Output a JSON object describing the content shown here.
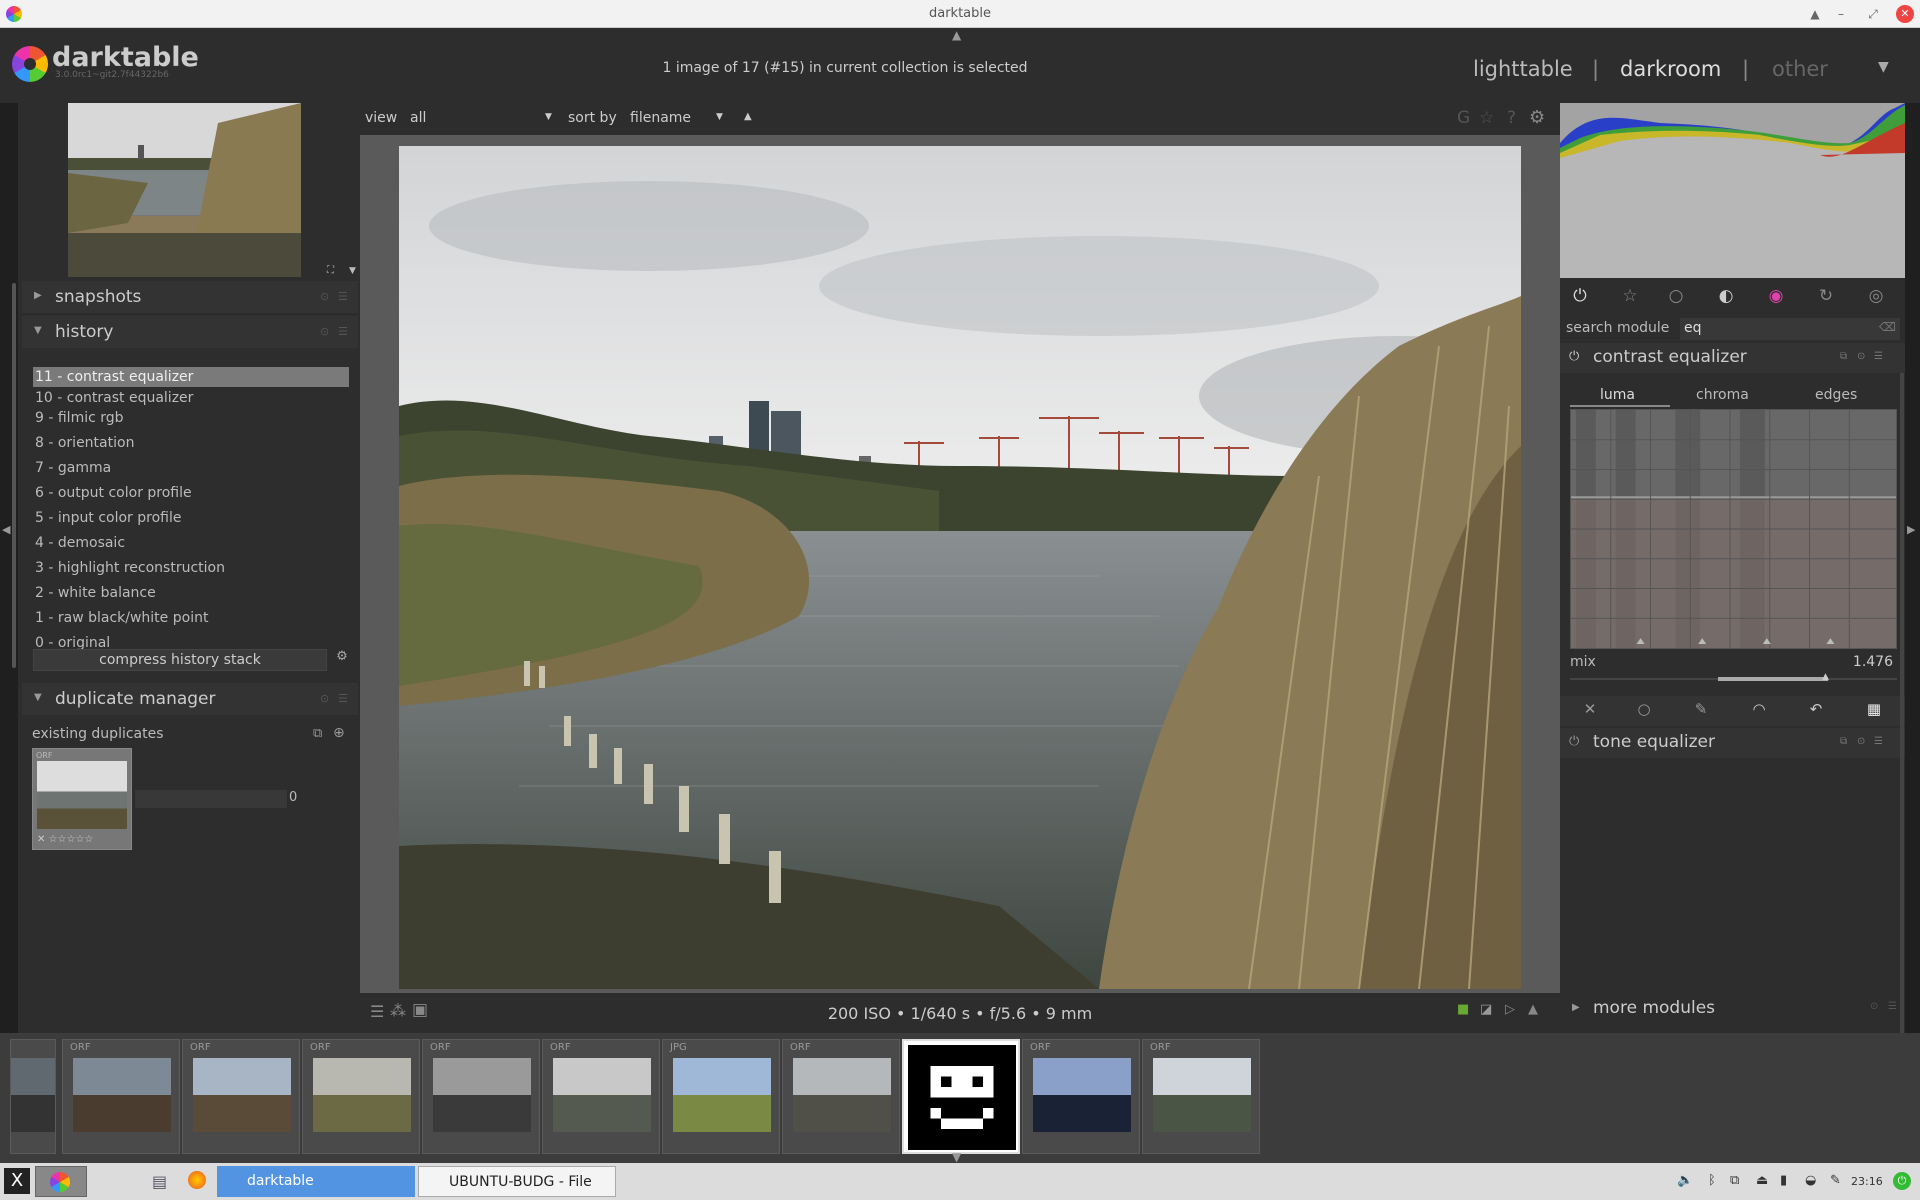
{
  "window": {
    "title": "darktable"
  },
  "header": {
    "logo": "darktable",
    "version": "3.0.0rc1~git2.7f44322b6",
    "selection_info": "1 image of 17 (#15) in current collection is selected",
    "views": {
      "lighttable": "lighttable",
      "sep1": "|",
      "darkroom": "darkroom",
      "sep2": "|",
      "other": "other"
    },
    "active_view": "darkroom"
  },
  "left": {
    "snapshots_label": "snapshots",
    "history_label": "history",
    "history_items": [
      "11 - contrast equalizer",
      "10 - contrast equalizer",
      "9 - filmic rgb",
      "8 - orientation",
      "7 - gamma",
      "6 - output color profile",
      "5 - input color profile",
      "4 - demosaic",
      "3 - highlight reconstruction",
      "2 - white balance",
      "1 - raw black/white point",
      "0 - original"
    ],
    "selected_history_index": 0,
    "compress_label": "compress history stack",
    "duplicate_label": "duplicate manager",
    "existing_duplicates": "existing duplicates",
    "dup_thumb_type": "ORF",
    "dup_value": "0"
  },
  "center_toolbar": {
    "view_label": "view",
    "view_value": "all",
    "sort_label": "sort by",
    "sort_value": "filename",
    "sort_dir_icon": "▲"
  },
  "exif": "200 ISO • 1/640 s • f/5.6 • 9 mm",
  "right": {
    "search_label": "search module",
    "search_value": "eq",
    "module1": "contrast equalizer",
    "tabs": [
      "luma",
      "chroma",
      "edges"
    ],
    "active_tab": "luma",
    "mix_label": "mix",
    "mix_value": "1.476",
    "module2": "tone equalizer",
    "more_modules": "more modules"
  },
  "filmstrip": [
    {
      "type": "",
      "colors": [
        "#606870",
        "#333"
      ]
    },
    {
      "type": "ORF",
      "colors": [
        "#7d8a95",
        "#4a3d30"
      ]
    },
    {
      "type": "ORF",
      "colors": [
        "#a7b5c5",
        "#5a4a38"
      ]
    },
    {
      "type": "ORF",
      "colors": [
        "#b8b8b0",
        "#6b6a45"
      ]
    },
    {
      "type": "ORF",
      "colors": [
        "#9a9a9a",
        "#3a3a3a"
      ]
    },
    {
      "type": "ORF",
      "colors": [
        "#c8c8c8",
        "#555a50"
      ]
    },
    {
      "type": "JPG",
      "colors": [
        "#9fb8d8",
        "#7a8a45"
      ]
    },
    {
      "type": "ORF",
      "colors": [
        "#b5b8bb",
        "#505048"
      ]
    },
    {
      "type": "",
      "colors": [
        "#000",
        "#000"
      ],
      "placeholder": true
    },
    {
      "type": "ORF",
      "colors": [
        "#8aa0c8",
        "#1a2235"
      ]
    },
    {
      "type": "ORF",
      "colors": [
        "#cfd4da",
        "#4a5545"
      ]
    }
  ],
  "taskbar": {
    "items": [
      "darktable",
      "UBUNTU-BUDG - File M..."
    ],
    "clock": "23:16"
  },
  "colors": {
    "bg_panel": "#2d2d2d",
    "bg_center": "#5a5a5a",
    "task_active": "#5294e2"
  }
}
